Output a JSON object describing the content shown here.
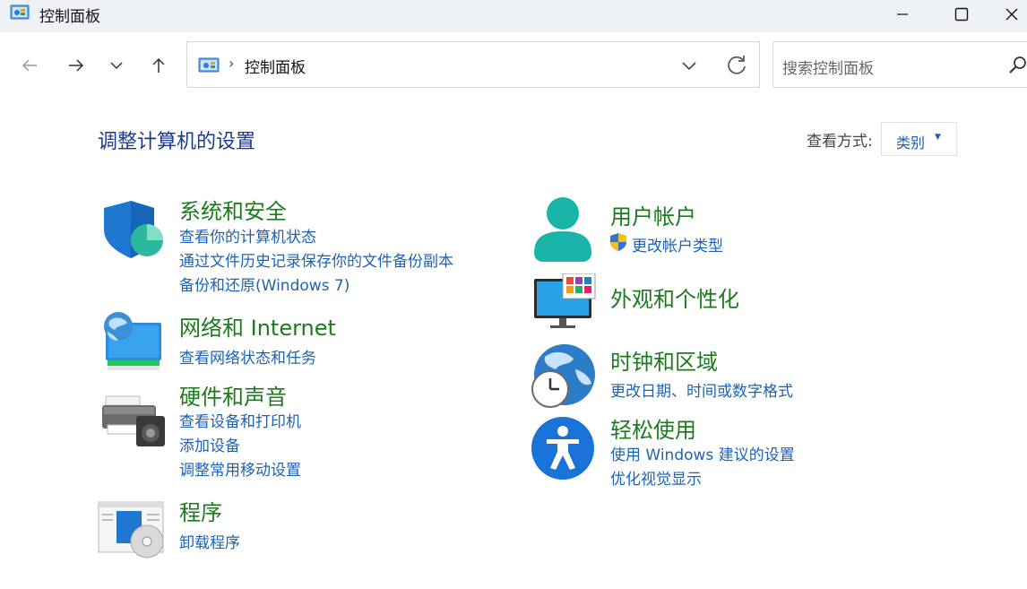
{
  "window": {
    "title": "控制面板"
  },
  "address_bar": {
    "separator": "›",
    "path": "控制面板"
  },
  "search": {
    "placeholder": "搜索控制面板"
  },
  "page": {
    "heading": "调整计算机的设置",
    "view_by_label": "查看方式:",
    "view_by_value": "类别"
  },
  "categories": {
    "system_security": {
      "title": "系统和安全",
      "links": [
        "查看你的计算机状态",
        "通过文件历史记录保存你的文件备份副本",
        "备份和还原(Windows 7)"
      ]
    },
    "network": {
      "title": "网络和 Internet",
      "links": [
        "查看网络状态和任务"
      ]
    },
    "hardware": {
      "title": "硬件和声音",
      "links": [
        "查看设备和打印机",
        "添加设备",
        "调整常用移动设置"
      ]
    },
    "programs": {
      "title": "程序",
      "links": [
        "卸载程序"
      ]
    },
    "user_accounts": {
      "title": "用户帐户",
      "links": [
        "更改帐户类型"
      ]
    },
    "appearance": {
      "title": "外观和个性化",
      "links": []
    },
    "clock_region": {
      "title": "时钟和区域",
      "links": [
        "更改日期、时间或数字格式"
      ]
    },
    "ease_of_access": {
      "title": "轻松使用",
      "links": [
        "使用 Windows 建议的设置",
        "优化视觉显示"
      ]
    }
  },
  "colors": {
    "category_title": "#1d7a1d",
    "link": "#1e62b4",
    "heading": "#1c3a8c",
    "titlebar_bg": "#eef2f7"
  }
}
